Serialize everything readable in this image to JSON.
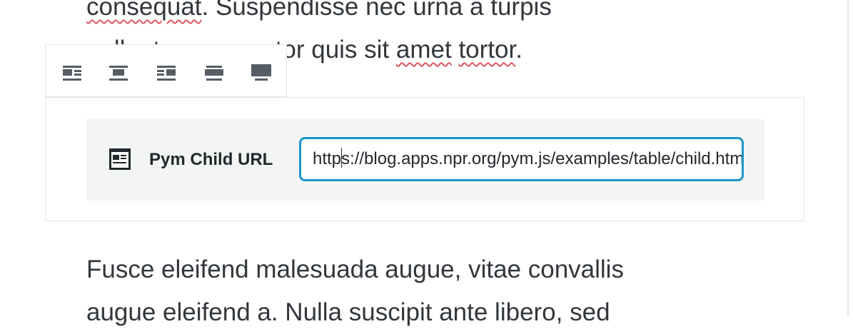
{
  "paragraphs": {
    "top_line1": "consequat. Suspendisse nec urna a turpis",
    "top_line2_pre": "pellentesque auctor quis sit ",
    "top_line2_w1": "amet",
    "top_line2_space": " ",
    "top_line2_w2": "tortor",
    "top_line2_end": ".",
    "bottom_line1": "Fusce eleifend malesuada augue, vitae convallis",
    "bottom_line2": "augue eleifend a. Nulla suscipit ante libero, sed"
  },
  "toolbar": {
    "buttons": [
      {
        "name": "align-left-icon",
        "label": "Align left"
      },
      {
        "name": "align-center-icon",
        "label": "Align center"
      },
      {
        "name": "align-right-icon",
        "label": "Align right"
      },
      {
        "name": "wide-width-icon",
        "label": "Wide width"
      },
      {
        "name": "full-width-icon",
        "label": "Full width"
      }
    ]
  },
  "embed": {
    "icon": "embed-block-icon",
    "label": "Pym Child URL",
    "url_before_caret": "http",
    "url_after_caret": "s://blog.apps.npr.org/pym.js/examples/table/child.html"
  },
  "colors": {
    "accent": "#1a96c9",
    "text": "#32373c",
    "placeholder_bg": "#f3f5f4",
    "border": "#e2e4e7",
    "spellcheck": "#e0565d"
  }
}
